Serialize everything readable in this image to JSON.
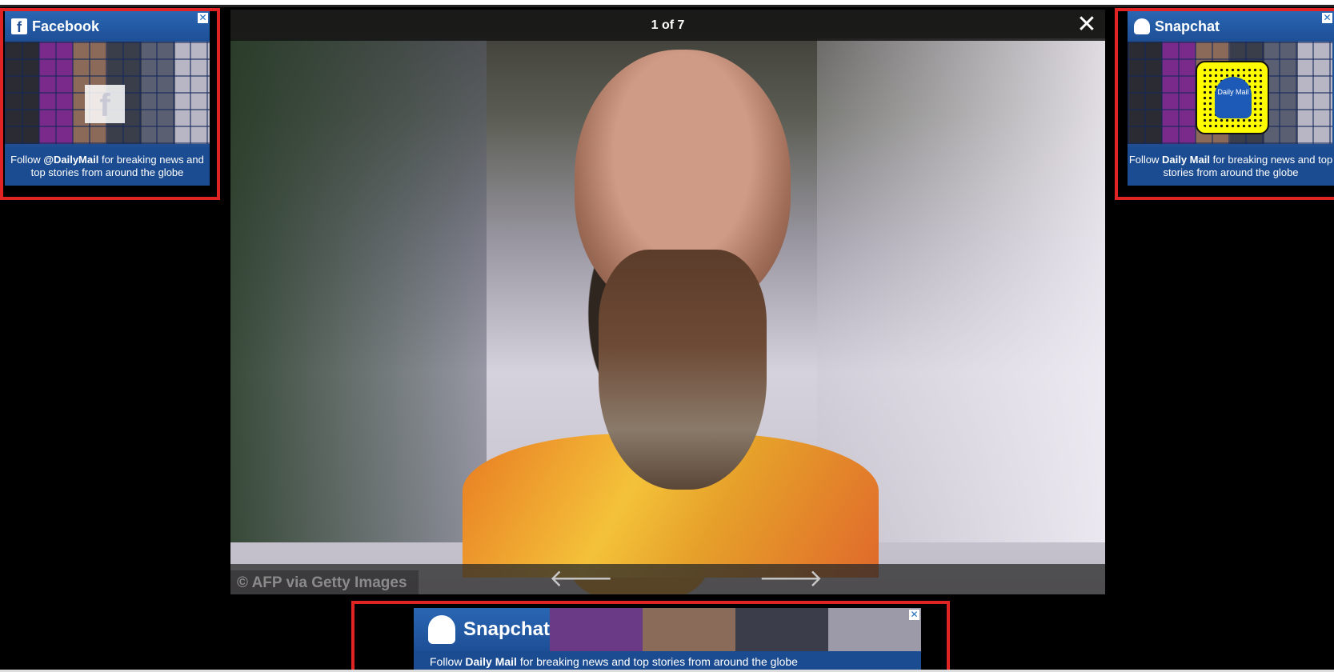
{
  "gallery": {
    "counter": "1 of 7",
    "close_symbol": "✕",
    "credit": "© AFP via Getty Images",
    "prev_symbol": "🡐",
    "next_symbol": "🡒"
  },
  "ad_left": {
    "platform": "Facebook",
    "close_symbol": "✕",
    "text_pre": "Follow ",
    "text_bold": "@DailyMail",
    "text_post": " for breaking news and top stories from around the globe"
  },
  "ad_right": {
    "platform": "Snapchat",
    "close_symbol": "✕",
    "snapcode_label": "Daily Mail",
    "text_pre": "Follow ",
    "text_bold": "Daily Mail",
    "text_post": " for breaking news and top stories from around the globe"
  },
  "ad_bottom": {
    "platform": "Snapchat",
    "close_symbol": "✕",
    "text_pre": "Follow ",
    "text_bold": "Daily Mail",
    "text_post": " for breaking news and top stories from around the globe"
  },
  "colors": {
    "ad_blue": "#1f4e92",
    "highlight_red": "#e02424",
    "snap_yellow": "#fffc00"
  }
}
